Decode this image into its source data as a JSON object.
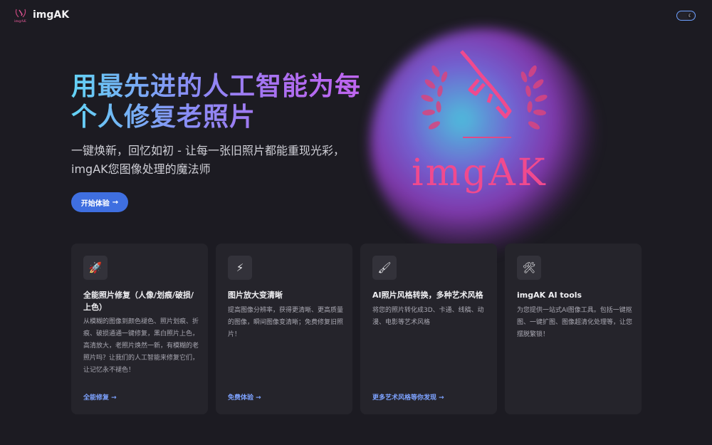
{
  "header": {
    "logo_text": "imgAK",
    "brand": "imgAK",
    "theme_toggle_icon": "moon-icon"
  },
  "hero": {
    "title": "用最先进的人工智能为每个人修复老照片",
    "subtitle": "一键焕新，回忆如初 - 让每一张旧照片都能重现光彩，imgAK您图像处理的魔法师",
    "cta_label": "开始体验",
    "cta_arrow": "→",
    "logo_text": "imgAK",
    "colors": {
      "title_gradient_start": "#63d3f5",
      "title_gradient_end": "#c164ef",
      "cta": "#3f6fe0",
      "logo_pink": "#f04a8e"
    }
  },
  "cards": [
    {
      "icon": "rocket-icon",
      "glyph": "🚀",
      "title": "全能照片修复（人像/划痕/破损/上色）",
      "desc": "从模糊的图像到颜色褪色、照片划痕、折痕、破损通通一键修复，黑白照片上色，高清放大，老照片焕然一新，有模糊的老照片吗？让我们的人工智能来修复它们，让记忆永不褪色！",
      "link": "全能修复 →"
    },
    {
      "icon": "lightning-icon",
      "glyph": "⚡",
      "title": "图片放大变清晰",
      "desc": "提高图像分辨率，获得更清晰、更高质量的图像，瞬间图像变清晰；免费修复旧照片！",
      "link": "免费体验 →"
    },
    {
      "icon": "paintbrush-icon",
      "glyph": "🖌",
      "title": "AI照片风格转换，多种艺术风格",
      "desc": "将您的照片转化成3D、卡通、线稿、动漫、电影等艺术风格",
      "link": "更多艺术风格等你发现 →"
    },
    {
      "icon": "tools-icon",
      "glyph": "🛠",
      "title": "imgAK AI tools",
      "desc": "为您提供一站式AI图像工具。包括一键抠图、一键扩图、图像超清化处理等，让您摆脱繁锁！",
      "link": ""
    }
  ]
}
